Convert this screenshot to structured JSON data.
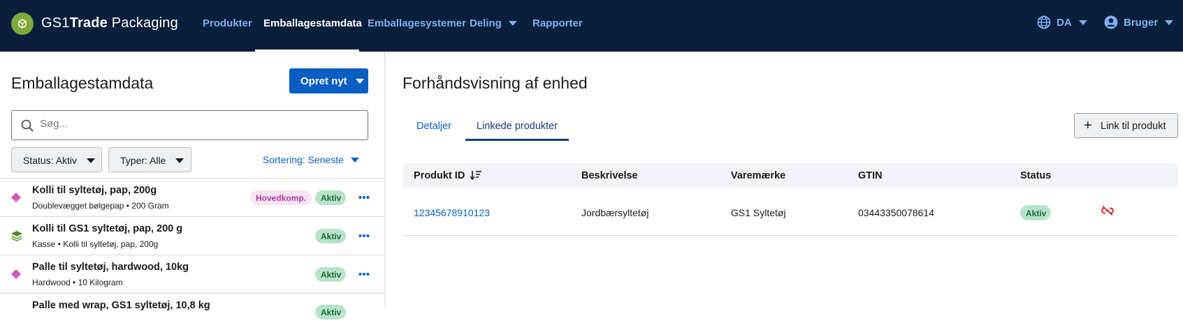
{
  "app": {
    "brand_prefix": "GS1",
    "brand_bold": "Trade",
    "brand_suffix": " Packaging",
    "accent_color": "#0a5dc2",
    "header_color": "#0a1f3c",
    "logo_color": "#7cab3b"
  },
  "nav": {
    "items": [
      {
        "label": "Produkter",
        "active": false
      },
      {
        "label": "Emballagestamdata",
        "active": true
      },
      {
        "label": "Emballagesystemer",
        "active": false
      },
      {
        "label": "Deling",
        "active": false,
        "dropdown": true
      },
      {
        "label": "Rapporter",
        "active": false
      }
    ],
    "language": "DA",
    "user": "Bruger"
  },
  "left": {
    "title": "Emballagestamdata",
    "create_button": "Opret nyt",
    "search_placeholder": "Søg...",
    "filters": {
      "status": "Status: Aktiv",
      "types": "Typer: Alle",
      "sort": "Sortering: Seneste"
    },
    "items": [
      {
        "icon": "diamond-icon",
        "title": "Kolli til syltetøj, pap, 200g",
        "sub": "Doublevægget bølgepap • 200 Gram",
        "role": "Hovedkomp.",
        "status": "Aktiv"
      },
      {
        "icon": "layers-icon",
        "title": "Kolli til GS1 syltetøj, pap, 200 g",
        "sub": "Kasse • Kolli til syltetøj, pap, 200g",
        "role": "",
        "status": "Aktiv"
      },
      {
        "icon": "diamond-icon",
        "title": "Palle til syltetøj, hardwood, 10kg",
        "sub": "Hardwood • 10 Kilogram",
        "role": "",
        "status": "Aktiv"
      },
      {
        "icon": "diamond-icon",
        "title": "Palle med wrap, GS1 syltetøj, 10,8 kg",
        "sub": "",
        "role": "",
        "status": "Aktiv"
      }
    ]
  },
  "right": {
    "title": "Forhåndsvisning af enhed",
    "tabs": [
      {
        "label": "Detaljer",
        "active": false
      },
      {
        "label": "Linkede produkter",
        "active": true
      }
    ],
    "link_button": "Link til produkt",
    "table": {
      "headers": [
        "Produkt ID",
        "Beskrivelse",
        "Varemærke",
        "GTIN",
        "Status"
      ],
      "rows": [
        {
          "id": "12345678910123",
          "description": "Jordbærsyltetøj",
          "brand": "GS1 Syltetøj",
          "gtin": "03443350078614",
          "status": "Aktiv"
        }
      ]
    }
  }
}
